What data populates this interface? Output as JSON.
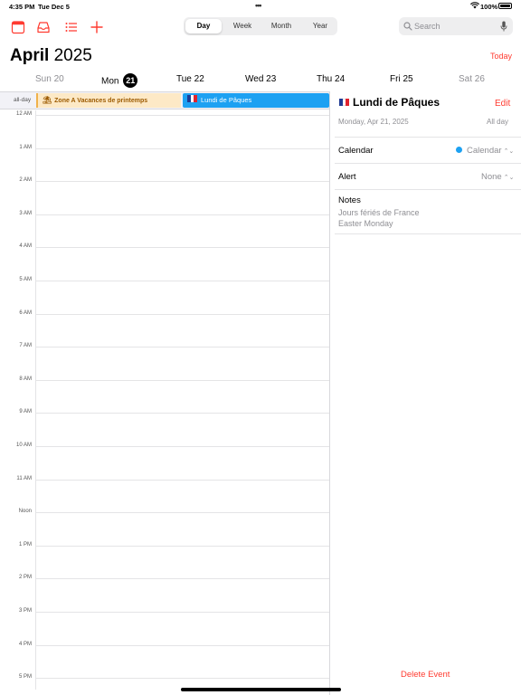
{
  "status_bar": {
    "time": "4:35 PM",
    "date": "Tue Dec 5",
    "battery": "100%"
  },
  "toolbar": {
    "view_modes": [
      "Day",
      "Week",
      "Month",
      "Year"
    ],
    "active_view": "Day",
    "search_placeholder": "Search",
    "accent_color": "#ff3b30"
  },
  "header": {
    "month": "April",
    "year": "2025",
    "today_label": "Today"
  },
  "week": {
    "days": [
      {
        "label": "Sun 20",
        "weekend": true
      },
      {
        "label": "Mon",
        "number": "21",
        "today": true
      },
      {
        "label": "Tue 22"
      },
      {
        "label": "Wed 23"
      },
      {
        "label": "Thu 24"
      },
      {
        "label": "Fri 25"
      },
      {
        "label": "Sat 26",
        "weekend": true
      }
    ]
  },
  "all_day": {
    "label": "all-day",
    "events": [
      {
        "title": "Zone A  Vacances de printemps",
        "color": "#fde9c6",
        "text_color": "#9c5a00"
      },
      {
        "title": "Lundi de Pâques",
        "color": "#1da1f2"
      }
    ]
  },
  "hours": [
    "12 AM",
    "1 AM",
    "2 AM",
    "3 AM",
    "4 AM",
    "5 AM",
    "6 AM",
    "7 AM",
    "8 AM",
    "9 AM",
    "10 AM",
    "11 AM",
    "Noon",
    "1 PM",
    "2 PM",
    "3 PM",
    "4 PM",
    "5 PM"
  ],
  "event_detail": {
    "title": "Lundi de Pâques",
    "edit_label": "Edit",
    "date": "Monday, Apr 21, 2025",
    "all_day": "All day",
    "calendar_label": "Calendar",
    "calendar_value": "Calendar",
    "calendar_color": "#1da1f2",
    "alert_label": "Alert",
    "alert_value": "None",
    "notes_label": "Notes",
    "notes": [
      "Jours fériés de France",
      "Easter Monday"
    ],
    "delete_label": "Delete Event"
  }
}
